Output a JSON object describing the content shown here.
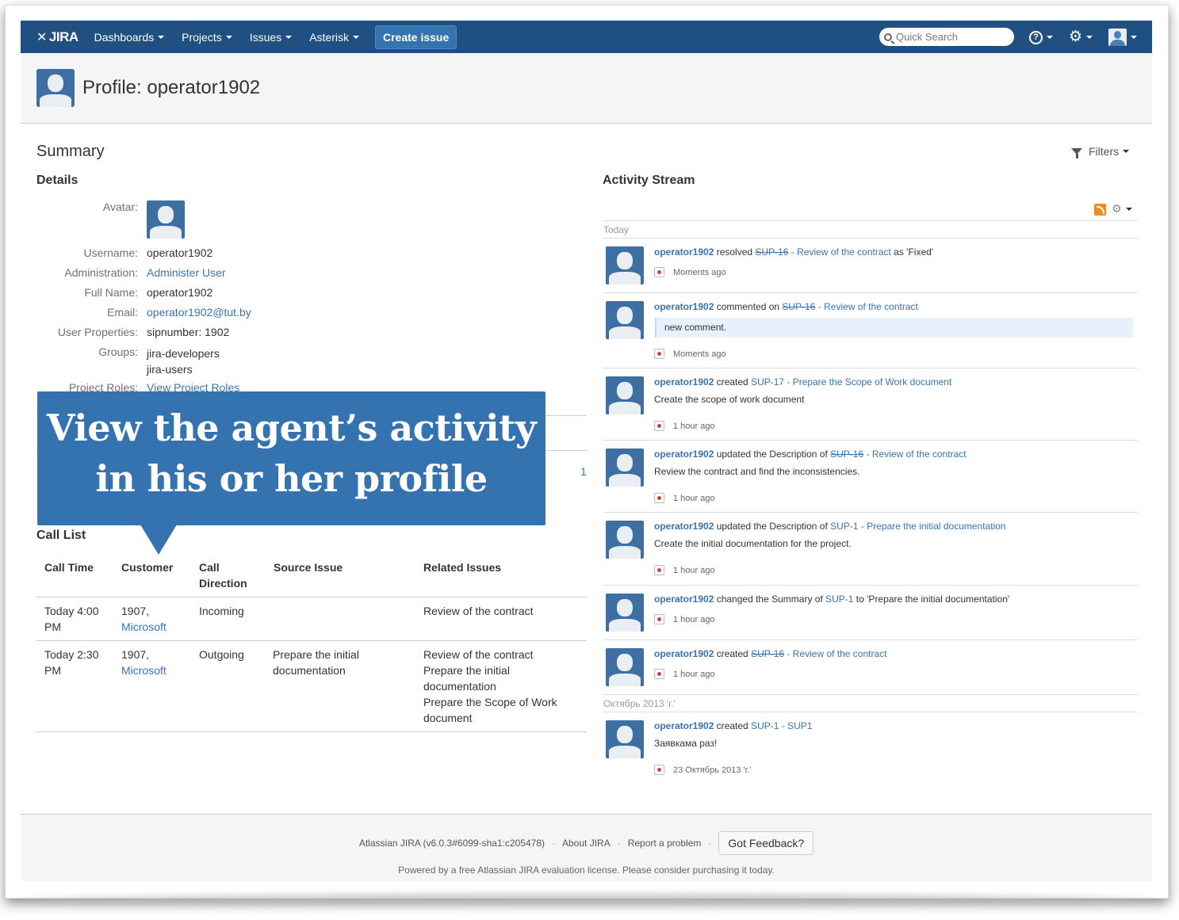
{
  "header": {
    "logo": "JIRA",
    "nav": [
      "Dashboards",
      "Projects",
      "Issues",
      "Asterisk"
    ],
    "create_label": "Create issue",
    "search_placeholder": "Quick Search"
  },
  "profile": {
    "title": "Profile: operator1902"
  },
  "summary": {
    "title": "Summary",
    "filters_label": "Filters"
  },
  "details": {
    "title": "Details",
    "labels": {
      "avatar": "Avatar:",
      "username": "Username:",
      "administration": "Administration:",
      "full_name": "Full Name:",
      "email": "Email:",
      "user_properties": "User Properties:",
      "groups": "Groups:",
      "project_roles": "Project Roles:"
    },
    "values": {
      "username": "operator1902",
      "administration": "Administer User",
      "full_name": "operator1902",
      "email": "operator1902@tut.by",
      "user_properties": "sipnumber: 1902",
      "group_1": "jira-developers",
      "group_2": "jira-users",
      "project_roles": "View Project Roles"
    },
    "hidden_count": "1"
  },
  "callout": {
    "line1": "View the agent’s activity",
    "line2": "in his or her profile"
  },
  "call_list": {
    "title": "Call List",
    "headers": [
      "Call Time",
      "Customer",
      "Call",
      "Direction",
      "Source Issue",
      "Related Issues"
    ],
    "rows": [
      {
        "time_1": "Today 4:00",
        "time_2": "PM",
        "customer_1": "1907,",
        "customer_2": "Microsoft",
        "direction": "Incoming",
        "source_1": "",
        "source_2": "",
        "related": [
          "Review of the contract"
        ]
      },
      {
        "time_1": "Today 2:30",
        "time_2": "PM",
        "customer_1": "1907,",
        "customer_2": "Microsoft",
        "direction": "Outgoing",
        "source_1": "Prepare the initial",
        "source_2": "documentation",
        "related": [
          "Review of the contract",
          "Prepare the initial",
          "documentation",
          "Prepare the Scope of Work",
          "document"
        ]
      }
    ]
  },
  "activity": {
    "title": "Activity Stream",
    "day_today": "Today",
    "day_october": "Октябрь 2013 'г.'",
    "entries": [
      {
        "user": "operator1902",
        "action": " resolved ",
        "key": "SUP-16",
        "rest": " - Review of the contract",
        "suffix": " as 'Fixed'",
        "time": "Moments ago"
      },
      {
        "user": "operator1902",
        "action": " commented on ",
        "key": "SUP-16",
        "rest": " - Review of the contract",
        "comment": "new comment.",
        "time": "Moments ago"
      },
      {
        "user": "operator1902",
        "action": " created ",
        "link": "SUP-17 - Prepare the Scope of Work document",
        "body": "Create the scope of work document",
        "time": "1 hour ago"
      },
      {
        "user": "operator1902",
        "action": " updated the Description of ",
        "key": "SUP-16",
        "rest": " - Review of the contract",
        "body": "Review the contract and find the inconsistencies.",
        "time": "1 hour ago"
      },
      {
        "user": "operator1902",
        "action": " updated the Description of ",
        "link": "SUP-1 - Prepare the initial documentation",
        "body": "Create the initial documentation for the project.",
        "time": "1 hour ago"
      },
      {
        "user": "operator1902",
        "action": " changed the Summary of ",
        "link": "SUP-1",
        "suffix": " to 'Prepare the initial documentation'",
        "time": "1 hour ago"
      },
      {
        "user": "operator1902",
        "action": " created ",
        "key": "SUP-16",
        "rest": " - Review of the contract",
        "time": "1 hour ago"
      },
      {
        "user": "operator1902",
        "action": " created ",
        "link": "SUP-1 - SUP1",
        "body": "Заявкама раз!",
        "time": "23 Октябрь 2013 'г.'"
      }
    ]
  },
  "footer": {
    "version": "Atlassian JIRA (v6.0.3#6099-sha1:c205478)",
    "about": "About JIRA",
    "report": "Report a problem",
    "feedback": "Got Feedback?",
    "note": "Powered by a free Atlassian JIRA evaluation license. Please consider purchasing it today.",
    "sep": "·"
  },
  "colors": {
    "header_bg": "#205081",
    "accent": "#3572b0",
    "link": "#3b73af"
  }
}
